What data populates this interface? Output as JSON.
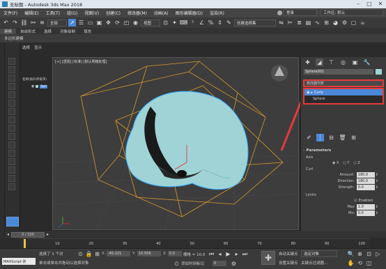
{
  "window": {
    "title": "无标题 - Autodesk 3ds Max 2018"
  },
  "menubar": {
    "items": [
      "文件(F)",
      "编辑(E)",
      "工具(T)",
      "组(G)",
      "视图(V)",
      "创建(C)",
      "修改器(M)",
      "动画(A)",
      "图形编辑器(D)",
      "渲染(R)"
    ],
    "signin": "登录",
    "workspace": "工作区: 默认"
  },
  "toolbar": {
    "filter": "全部",
    "view": "视图",
    "selection_set": "创建选择集"
  },
  "ribbon_tabs": [
    "建模",
    "自由形式",
    "选择",
    "对象绘制",
    "填充"
  ],
  "ribbon_sub": "多边形建模",
  "scene_explorer": {
    "tabs": [
      "选择",
      "显示"
    ],
    "header": "名称(按升序排序)",
    "item": "Sph"
  },
  "viewport": {
    "label": "[+] [透视] [标准] [默认明暗处理]"
  },
  "command_panel": {
    "object_name": "Sphere001",
    "modifier_list": "修改器列表",
    "stack": [
      "Curly",
      "Sphere"
    ],
    "rollout_title": "Parameters",
    "axis_label": "Axis",
    "axes": [
      "X",
      "Y",
      "Z"
    ],
    "curl_label": "Curl",
    "amount_label": "Amount:",
    "amount_value": "180.0",
    "direction_label": "Direction:",
    "direction_value": "180.0",
    "strength_label": "Strength:",
    "strength_value": "0.0",
    "limits_label": "Limits",
    "enabled_label": "Enabled",
    "max_label": "Max",
    "max_value": "1.0",
    "min_label": "Min",
    "min_value": "0.0"
  },
  "timeline": {
    "frame": "0 / 100",
    "ticks": [
      "0",
      "10",
      "20",
      "30",
      "40",
      "50",
      "60",
      "70",
      "80",
      "90",
      "100"
    ]
  },
  "status": {
    "maxscript": "MAXScript 侦",
    "selected": "选择了 1 个对",
    "prompt": "单击或单击并拖动以选择对象",
    "x_label": "X:",
    "x_value": "-45.221",
    "y_label": "Y:",
    "y_value": "10.556",
    "z_label": "Z:",
    "z_value": "0.0",
    "grid": "栅格 = 10.0",
    "add_time_tag": "添加时间标记",
    "auto_key": "自动关键点",
    "selected_object": "选定对象",
    "set_key": "设置关键点",
    "key_filters": "关键点过滤器...",
    "frame_value": "0"
  },
  "colors": {
    "highlight_red": "#e83a3a",
    "selection_blue": "#4a88d8",
    "sphere": "#9fd3d6",
    "cage": "#d89a2e"
  }
}
